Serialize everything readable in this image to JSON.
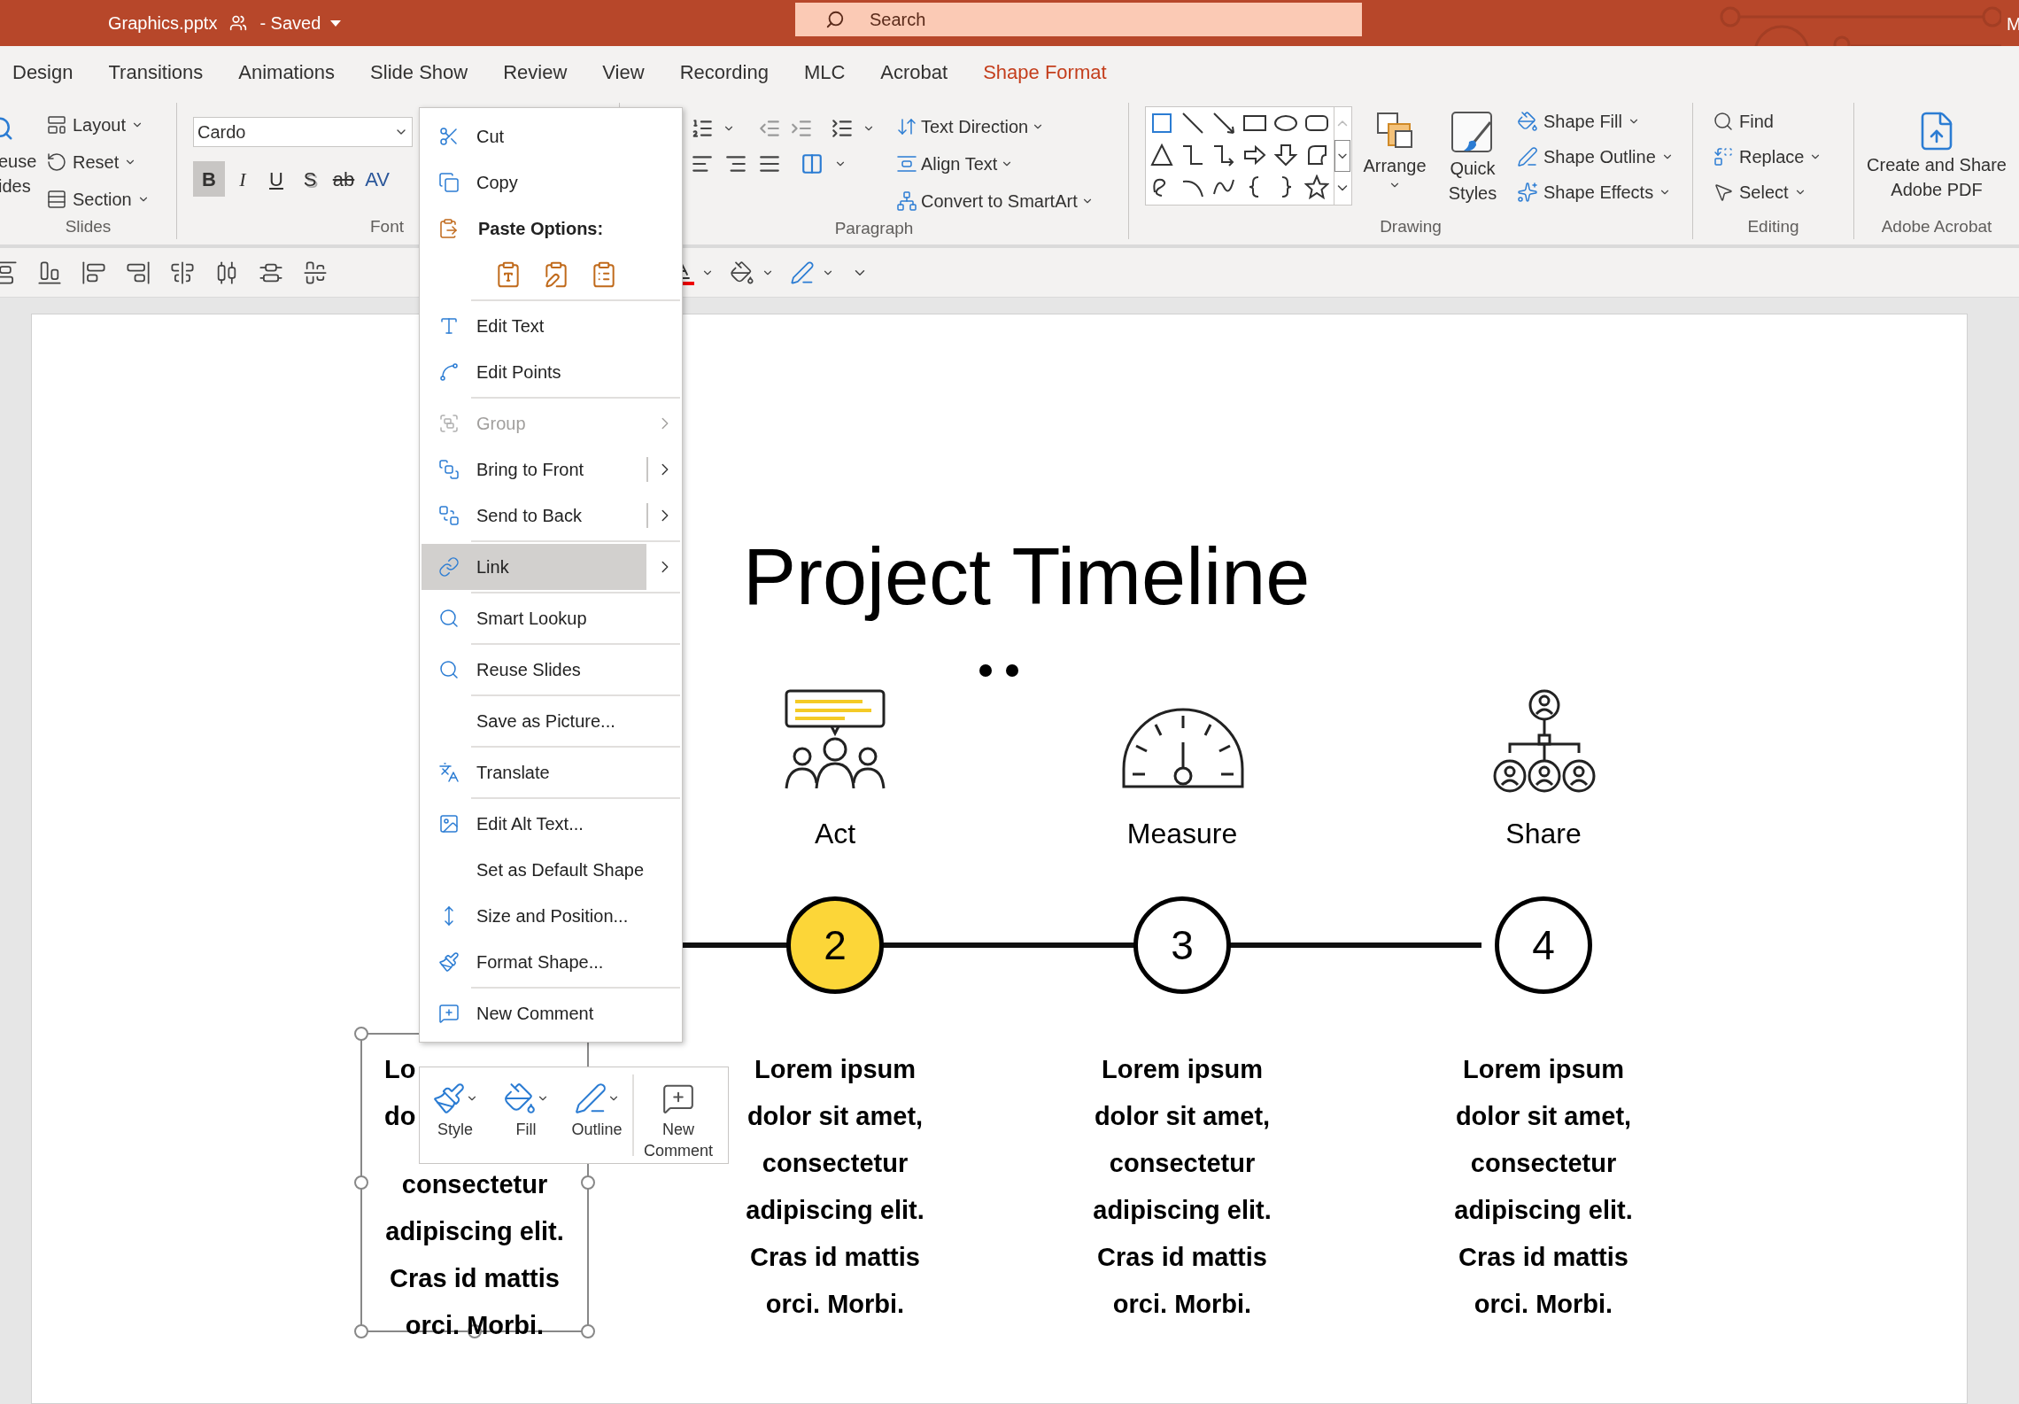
{
  "title_bar": {
    "file_name": "Graphics.pptx",
    "status": "- Saved",
    "search_placeholder": "Search",
    "edge_text": "M"
  },
  "tabs": [
    {
      "label": "Design",
      "kind": "normal"
    },
    {
      "label": "Transitions",
      "kind": "normal"
    },
    {
      "label": "Animations",
      "kind": "normal"
    },
    {
      "label": "Slide Show",
      "kind": "normal"
    },
    {
      "label": "Review",
      "kind": "normal"
    },
    {
      "label": "View",
      "kind": "normal"
    },
    {
      "label": "Recording",
      "kind": "normal"
    },
    {
      "label": "MLC",
      "kind": "normal"
    },
    {
      "label": "Acrobat",
      "kind": "normal"
    },
    {
      "label": "Shape Format",
      "kind": "contextual"
    }
  ],
  "ribbon": {
    "slides_group": {
      "cut_label_top": "euse",
      "cut_label_bottom": "ides",
      "buttons": [
        "Layout",
        "Reset",
        "Section"
      ],
      "label": "Slides"
    },
    "font_group": {
      "font_name": "Cardo",
      "styles": [
        {
          "text": "B",
          "kind": "bold",
          "on": true
        },
        {
          "text": "I",
          "kind": "italic",
          "on": false
        },
        {
          "text": "U",
          "kind": "underline",
          "on": false
        },
        {
          "text": "S",
          "kind": "shadow",
          "on": false
        },
        {
          "text": "ab",
          "kind": "strike",
          "on": false
        },
        {
          "text": "AV",
          "kind": "spacing",
          "on": false
        }
      ],
      "label": "Font"
    },
    "paragraph_group": {
      "buttons": [
        "Text Direction",
        "Align Text",
        "Convert to SmartArt"
      ],
      "label": "Paragraph"
    },
    "drawing_group": {
      "arrange": "Arrange",
      "quick_styles": "Quick Styles",
      "buttons": [
        "Shape Fill",
        "Shape Outline",
        "Shape Effects"
      ],
      "label": "Drawing"
    },
    "editing_group": {
      "buttons": [
        "Find",
        "Replace",
        "Select"
      ],
      "label": "Editing"
    },
    "acrobat_group": {
      "button": "Create and Share Adobe PDF",
      "label": "Adobe Acrobat"
    }
  },
  "context_menu": [
    {
      "kind": "command",
      "label": "Cut",
      "disabled": false,
      "selected": false,
      "submenu": false,
      "split": false
    },
    {
      "kind": "command",
      "label": "Copy",
      "disabled": false,
      "selected": false,
      "submenu": false,
      "split": false
    },
    {
      "kind": "header",
      "label": "Paste Options:"
    },
    {
      "kind": "paste_options"
    },
    {
      "kind": "separator"
    },
    {
      "kind": "command",
      "label": "Edit Text",
      "disabled": false,
      "selected": false,
      "submenu": false,
      "split": false
    },
    {
      "kind": "command",
      "label": "Edit Points",
      "disabled": false,
      "selected": false,
      "submenu": false,
      "split": false
    },
    {
      "kind": "separator"
    },
    {
      "kind": "command",
      "label": "Group",
      "disabled": true,
      "selected": false,
      "submenu": true,
      "split": false
    },
    {
      "kind": "command",
      "label": "Bring to Front",
      "disabled": false,
      "selected": false,
      "submenu": true,
      "split": true
    },
    {
      "kind": "command",
      "label": "Send to Back",
      "disabled": false,
      "selected": false,
      "submenu": true,
      "split": true
    },
    {
      "kind": "separator"
    },
    {
      "kind": "command",
      "label": "Link",
      "disabled": false,
      "selected": true,
      "submenu": true,
      "split": false
    },
    {
      "kind": "separator"
    },
    {
      "kind": "command",
      "label": "Smart Lookup",
      "disabled": false,
      "selected": false,
      "submenu": false,
      "split": false
    },
    {
      "kind": "separator"
    },
    {
      "kind": "command",
      "label": "Reuse Slides",
      "disabled": false,
      "selected": false,
      "submenu": false,
      "split": false
    },
    {
      "kind": "separator"
    },
    {
      "kind": "command",
      "label": "Save as Picture...",
      "disabled": false,
      "selected": false,
      "submenu": false,
      "split": false
    },
    {
      "kind": "separator"
    },
    {
      "kind": "command",
      "label": "Translate",
      "disabled": false,
      "selected": false,
      "submenu": false,
      "split": false
    },
    {
      "kind": "separator"
    },
    {
      "kind": "command",
      "label": "Edit Alt Text...",
      "disabled": false,
      "selected": false,
      "submenu": false,
      "split": false
    },
    {
      "kind": "command",
      "label": "Set as Default Shape",
      "disabled": false,
      "selected": false,
      "submenu": false,
      "split": false
    },
    {
      "kind": "command",
      "label": "Size and Position...",
      "disabled": false,
      "selected": false,
      "submenu": false,
      "split": false
    },
    {
      "kind": "command",
      "label": "Format Shape...",
      "disabled": false,
      "selected": false,
      "submenu": false,
      "split": false
    },
    {
      "kind": "separator"
    },
    {
      "kind": "command",
      "label": "New Comment",
      "disabled": false,
      "selected": false,
      "submenu": false,
      "split": false
    }
  ],
  "mini_toolbar": [
    "Style",
    "Fill",
    "Outline",
    "New Comment"
  ],
  "slide": {
    "title": "Project Timeline",
    "partial_text": "Lo\ndo",
    "first_text": "consectetur\nadipiscing elit.\nCras id mattis\norci. Morbi.",
    "steps": [
      {
        "label": "Act",
        "number": "2",
        "current": true,
        "text": "Lorem ipsum\ndolor sit amet,\nconsectetur\nadipiscing elit.\nCras id mattis\norci. Morbi."
      },
      {
        "label": "Measure",
        "number": "3",
        "current": false,
        "text": "Lorem ipsum\ndolor sit amet,\nconsectetur\nadipiscing elit.\nCras id mattis\norci. Morbi."
      },
      {
        "label": "Share",
        "number": "4",
        "current": false,
        "text": "Lorem ipsum\ndolor sit amet,\nconsectetur\nadipiscing elit.\nCras id mattis\norci. Morbi."
      }
    ]
  }
}
